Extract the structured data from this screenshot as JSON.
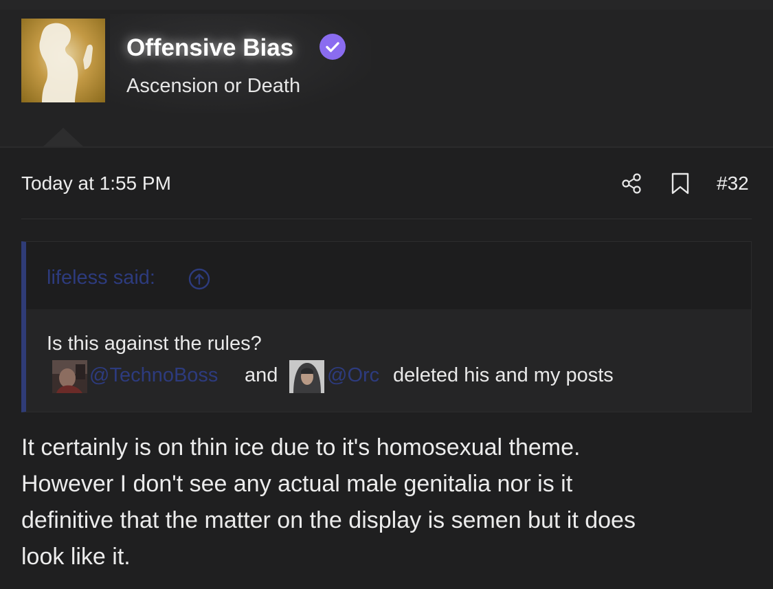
{
  "user": {
    "name": "Offensive Bias",
    "title": "Ascension or Death",
    "verified": true,
    "accent_color": "#8a6cf0"
  },
  "post": {
    "date": "Today at 1:55 PM",
    "number": "#32",
    "actions": [
      {
        "icon": "share-icon"
      },
      {
        "icon": "bookmark-icon"
      }
    ]
  },
  "quote": {
    "author": "lifeless said:",
    "border_color": "#2f3c77",
    "line1": "Is this against the rules?",
    "mention1": "@TechnoBoss",
    "connector": "and",
    "mention2": "@Orc",
    "line2_tail": "deleted his and my posts"
  },
  "body": {
    "lines": [
      "It certainly is on thin ice due to it's homosexual theme.",
      "However I don't see any actual male genitalia nor is it",
      "definitive that the matter on the display is semen but it does",
      "look like it."
    ]
  }
}
